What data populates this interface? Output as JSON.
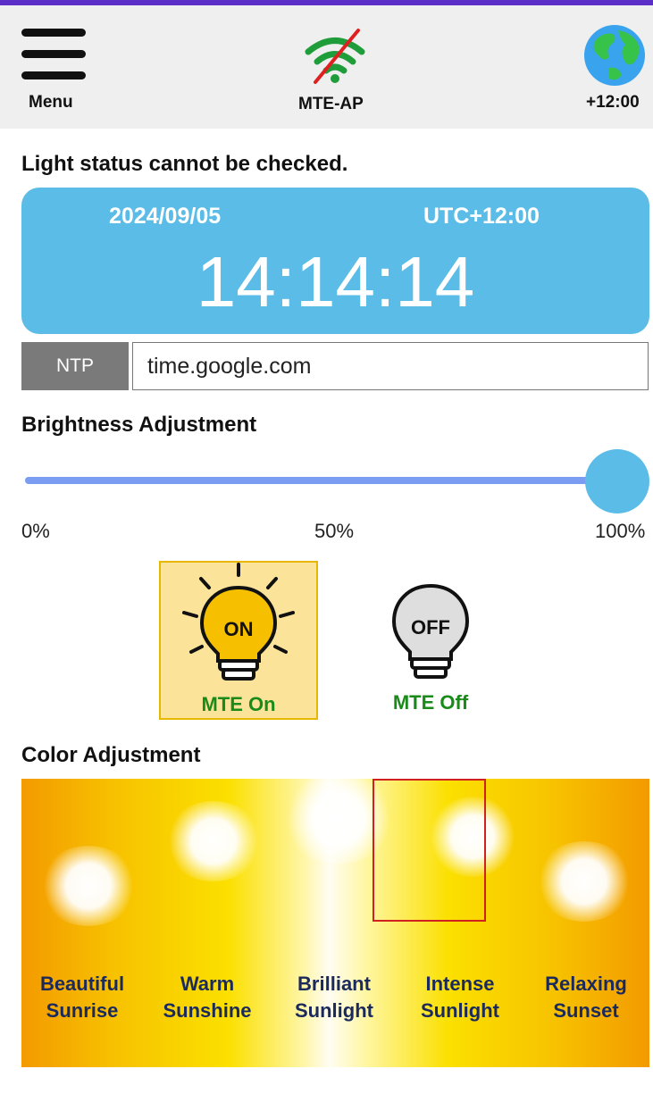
{
  "header": {
    "menu_label": "Menu",
    "wifi_label": "MTE-AP",
    "timezone_label": "+12:00"
  },
  "status_text": "Light status cannot be checked.",
  "clock": {
    "date": "2024/09/05",
    "timezone": "UTC+12:00",
    "time": "14:14:14"
  },
  "ntp": {
    "button_label": "NTP",
    "server_value": "time.google.com"
  },
  "brightness": {
    "title": "Brightness Adjustment",
    "value_percent": 100,
    "ticks": [
      "0%",
      "50%",
      "100%"
    ]
  },
  "power": {
    "on_icon_text": "ON",
    "on_label": "MTE On",
    "off_icon_text": "OFF",
    "off_label": "MTE Off",
    "selected": "on"
  },
  "color": {
    "title": "Color Adjustment",
    "selected_index": 3,
    "presets": [
      {
        "line1": "Beautiful",
        "line2": "Sunrise"
      },
      {
        "line1": "Warm",
        "line2": "Sunshine"
      },
      {
        "line1": "Brilliant",
        "line2": "Sunlight"
      },
      {
        "line1": "Intense",
        "line2": "Sunlight"
      },
      {
        "line1": "Relaxing",
        "line2": "Sunset"
      }
    ]
  },
  "colors": {
    "accent_blue": "#5bbce8",
    "slider_track": "#7a9df2",
    "label_green": "#1a8a1a",
    "selection_red": "#d02020"
  }
}
